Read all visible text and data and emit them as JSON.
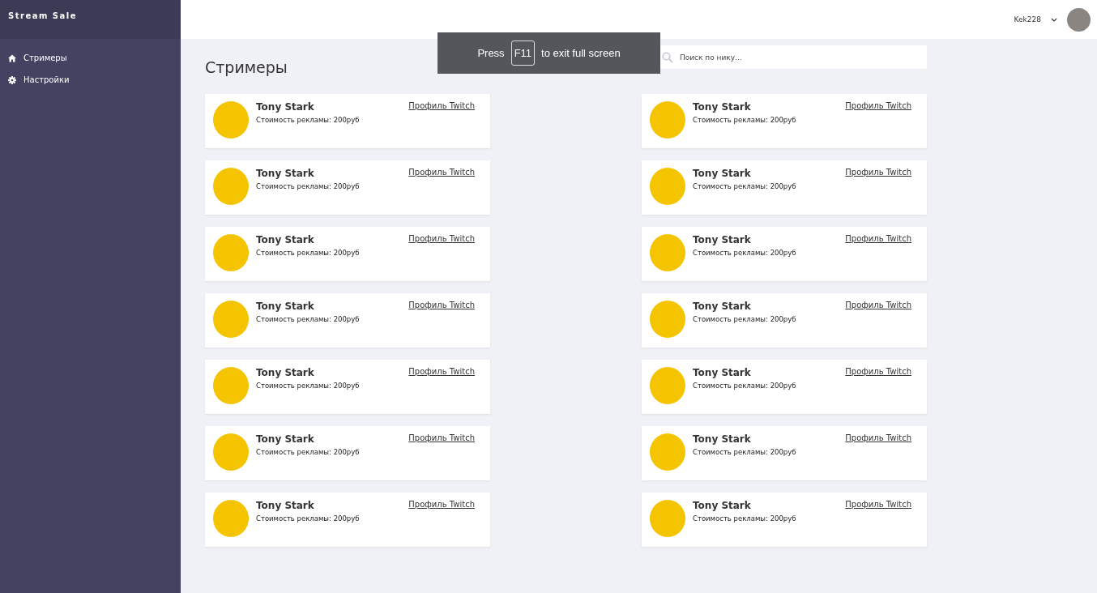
{
  "sidebar": {
    "logo": "Stream Sale",
    "items": [
      {
        "label": "Стримеры"
      },
      {
        "label": "Настройки"
      }
    ]
  },
  "header": {
    "username": "Kek228"
  },
  "page": {
    "title": "Стримеры",
    "search": {
      "placeholder": "Поиск по нику..."
    }
  },
  "streamers": [
    {
      "name": "Tony Stark",
      "price": "Стоимость рекламы: 200руб",
      "link": "Профиль Twitch"
    },
    {
      "name": "Tony Stark",
      "price": "Стоимость рекламы: 200руб",
      "link": "Профиль Twitch"
    },
    {
      "name": "Tony Stark",
      "price": "Стоимость рекламы: 200руб",
      "link": "Профиль Twitch"
    },
    {
      "name": "Tony Stark",
      "price": "Стоимость рекламы: 200руб",
      "link": "Профиль Twitch"
    },
    {
      "name": "Tony Stark",
      "price": "Стоимость рекламы: 200руб",
      "link": "Профиль Twitch"
    },
    {
      "name": "Tony Stark",
      "price": "Стоимость рекламы: 200руб",
      "link": "Профиль Twitch"
    },
    {
      "name": "Tony Stark",
      "price": "Стоимость рекламы: 200руб",
      "link": "Профиль Twitch"
    },
    {
      "name": "Tony Stark",
      "price": "Стоимость рекламы: 200руб",
      "link": "Профиль Twitch"
    },
    {
      "name": "Tony Stark",
      "price": "Стоимость рекламы: 200руб",
      "link": "Профиль Twitch"
    },
    {
      "name": "Tony Stark",
      "price": "Стоимость рекламы: 200руб",
      "link": "Профиль Twitch"
    },
    {
      "name": "Tony Stark",
      "price": "Стоимость рекламы: 200руб",
      "link": "Профиль Twitch"
    },
    {
      "name": "Tony Stark",
      "price": "Стоимость рекламы: 200руб",
      "link": "Профиль Twitch"
    },
    {
      "name": "Tony Stark",
      "price": "Стоимость рекламы: 200руб",
      "link": "Профиль Twitch"
    },
    {
      "name": "Tony Stark",
      "price": "Стоимость рекламы: 200руб",
      "link": "Профиль Twitch"
    }
  ],
  "fullscreen_notice": {
    "before": "Press",
    "key": "F11",
    "after": "to exit full screen"
  }
}
